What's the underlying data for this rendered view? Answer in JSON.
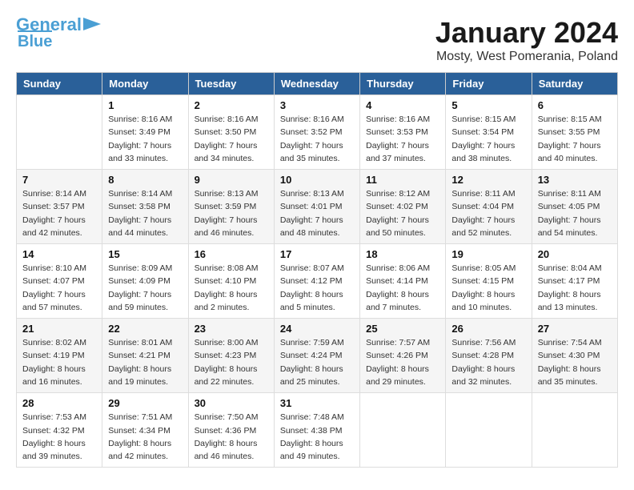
{
  "header": {
    "logo_line1": "General",
    "logo_line2": "Blue",
    "month": "January 2024",
    "location": "Mosty, West Pomerania, Poland"
  },
  "days_of_week": [
    "Sunday",
    "Monday",
    "Tuesday",
    "Wednesday",
    "Thursday",
    "Friday",
    "Saturday"
  ],
  "weeks": [
    [
      {
        "day": "",
        "info": ""
      },
      {
        "day": "1",
        "info": "Sunrise: 8:16 AM\nSunset: 3:49 PM\nDaylight: 7 hours\nand 33 minutes."
      },
      {
        "day": "2",
        "info": "Sunrise: 8:16 AM\nSunset: 3:50 PM\nDaylight: 7 hours\nand 34 minutes."
      },
      {
        "day": "3",
        "info": "Sunrise: 8:16 AM\nSunset: 3:52 PM\nDaylight: 7 hours\nand 35 minutes."
      },
      {
        "day": "4",
        "info": "Sunrise: 8:16 AM\nSunset: 3:53 PM\nDaylight: 7 hours\nand 37 minutes."
      },
      {
        "day": "5",
        "info": "Sunrise: 8:15 AM\nSunset: 3:54 PM\nDaylight: 7 hours\nand 38 minutes."
      },
      {
        "day": "6",
        "info": "Sunrise: 8:15 AM\nSunset: 3:55 PM\nDaylight: 7 hours\nand 40 minutes."
      }
    ],
    [
      {
        "day": "7",
        "info": "Sunrise: 8:14 AM\nSunset: 3:57 PM\nDaylight: 7 hours\nand 42 minutes."
      },
      {
        "day": "8",
        "info": "Sunrise: 8:14 AM\nSunset: 3:58 PM\nDaylight: 7 hours\nand 44 minutes."
      },
      {
        "day": "9",
        "info": "Sunrise: 8:13 AM\nSunset: 3:59 PM\nDaylight: 7 hours\nand 46 minutes."
      },
      {
        "day": "10",
        "info": "Sunrise: 8:13 AM\nSunset: 4:01 PM\nDaylight: 7 hours\nand 48 minutes."
      },
      {
        "day": "11",
        "info": "Sunrise: 8:12 AM\nSunset: 4:02 PM\nDaylight: 7 hours\nand 50 minutes."
      },
      {
        "day": "12",
        "info": "Sunrise: 8:11 AM\nSunset: 4:04 PM\nDaylight: 7 hours\nand 52 minutes."
      },
      {
        "day": "13",
        "info": "Sunrise: 8:11 AM\nSunset: 4:05 PM\nDaylight: 7 hours\nand 54 minutes."
      }
    ],
    [
      {
        "day": "14",
        "info": "Sunrise: 8:10 AM\nSunset: 4:07 PM\nDaylight: 7 hours\nand 57 minutes."
      },
      {
        "day": "15",
        "info": "Sunrise: 8:09 AM\nSunset: 4:09 PM\nDaylight: 7 hours\nand 59 minutes."
      },
      {
        "day": "16",
        "info": "Sunrise: 8:08 AM\nSunset: 4:10 PM\nDaylight: 8 hours\nand 2 minutes."
      },
      {
        "day": "17",
        "info": "Sunrise: 8:07 AM\nSunset: 4:12 PM\nDaylight: 8 hours\nand 5 minutes."
      },
      {
        "day": "18",
        "info": "Sunrise: 8:06 AM\nSunset: 4:14 PM\nDaylight: 8 hours\nand 7 minutes."
      },
      {
        "day": "19",
        "info": "Sunrise: 8:05 AM\nSunset: 4:15 PM\nDaylight: 8 hours\nand 10 minutes."
      },
      {
        "day": "20",
        "info": "Sunrise: 8:04 AM\nSunset: 4:17 PM\nDaylight: 8 hours\nand 13 minutes."
      }
    ],
    [
      {
        "day": "21",
        "info": "Sunrise: 8:02 AM\nSunset: 4:19 PM\nDaylight: 8 hours\nand 16 minutes."
      },
      {
        "day": "22",
        "info": "Sunrise: 8:01 AM\nSunset: 4:21 PM\nDaylight: 8 hours\nand 19 minutes."
      },
      {
        "day": "23",
        "info": "Sunrise: 8:00 AM\nSunset: 4:23 PM\nDaylight: 8 hours\nand 22 minutes."
      },
      {
        "day": "24",
        "info": "Sunrise: 7:59 AM\nSunset: 4:24 PM\nDaylight: 8 hours\nand 25 minutes."
      },
      {
        "day": "25",
        "info": "Sunrise: 7:57 AM\nSunset: 4:26 PM\nDaylight: 8 hours\nand 29 minutes."
      },
      {
        "day": "26",
        "info": "Sunrise: 7:56 AM\nSunset: 4:28 PM\nDaylight: 8 hours\nand 32 minutes."
      },
      {
        "day": "27",
        "info": "Sunrise: 7:54 AM\nSunset: 4:30 PM\nDaylight: 8 hours\nand 35 minutes."
      }
    ],
    [
      {
        "day": "28",
        "info": "Sunrise: 7:53 AM\nSunset: 4:32 PM\nDaylight: 8 hours\nand 39 minutes."
      },
      {
        "day": "29",
        "info": "Sunrise: 7:51 AM\nSunset: 4:34 PM\nDaylight: 8 hours\nand 42 minutes."
      },
      {
        "day": "30",
        "info": "Sunrise: 7:50 AM\nSunset: 4:36 PM\nDaylight: 8 hours\nand 46 minutes."
      },
      {
        "day": "31",
        "info": "Sunrise: 7:48 AM\nSunset: 4:38 PM\nDaylight: 8 hours\nand 49 minutes."
      },
      {
        "day": "",
        "info": ""
      },
      {
        "day": "",
        "info": ""
      },
      {
        "day": "",
        "info": ""
      }
    ]
  ]
}
